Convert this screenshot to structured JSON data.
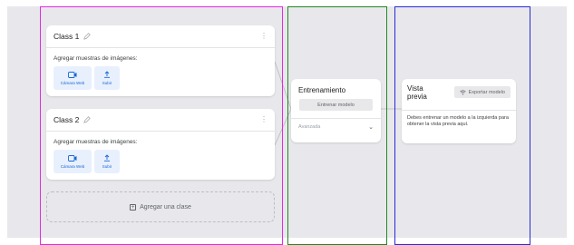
{
  "classes": [
    {
      "title": "Class 1",
      "samples_label": "Agregar muestras de imágenes:",
      "webcam_label": "Cámara Web",
      "upload_label": "Subir"
    },
    {
      "title": "Class 2",
      "samples_label": "Agregar muestras de imágenes:",
      "webcam_label": "Cámara Web",
      "upload_label": "Subir"
    }
  ],
  "add_class_label": "Agregar una clase",
  "training": {
    "title": "Entrenamiento",
    "button": "Entrenar modelo",
    "advanced": "Avanzada"
  },
  "preview": {
    "title": "Vista previa",
    "export_button": "Exportar modelo",
    "message": "Debes entrenar un modelo a la izquierda para obtener la vista previa aquí."
  },
  "colors": {
    "frame_classes": "#e628e6",
    "frame_training": "#1f8a1f",
    "frame_preview": "#2b2bd6",
    "accent": "#1967d2"
  },
  "icons": [
    "pencil-icon",
    "more-vert-icon",
    "webcam-icon",
    "upload-icon",
    "add-icon",
    "chevron-down-icon",
    "export-icon"
  ]
}
